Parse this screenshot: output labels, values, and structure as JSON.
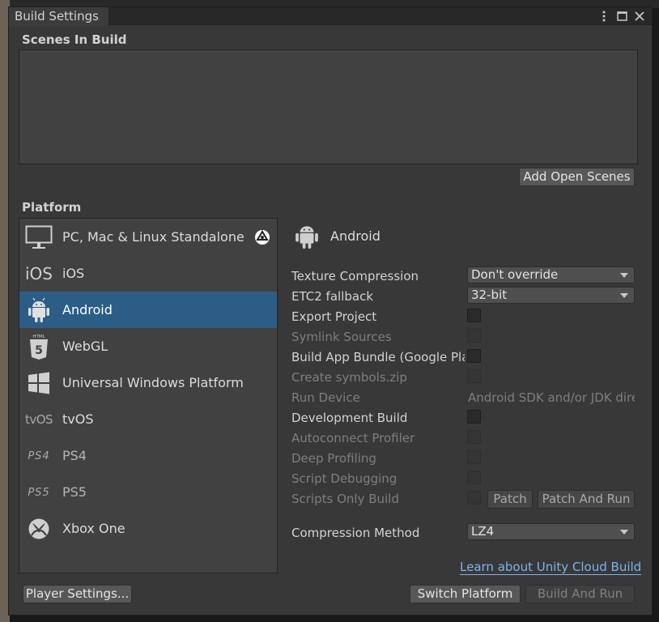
{
  "window": {
    "title": "Build Settings"
  },
  "scenes": {
    "heading": "Scenes In Build",
    "add_open_scenes": "Add Open Scenes"
  },
  "platform": {
    "heading": "Platform",
    "items": [
      {
        "label": "PC, Mac & Linux Standalone",
        "icon": "monitor-icon"
      },
      {
        "label": "iOS",
        "icon": "ios-icon",
        "icon_text": "iOS"
      },
      {
        "label": "Android",
        "icon": "android-icon"
      },
      {
        "label": "WebGL",
        "icon": "html5-icon",
        "icon_text": "HTML"
      },
      {
        "label": "Universal Windows Platform",
        "icon": "windows-icon"
      },
      {
        "label": "tvOS",
        "icon": "tvos-icon",
        "icon_text": "tvOS"
      },
      {
        "label": "PS4",
        "icon": "ps4-icon",
        "icon_text": "PS4"
      },
      {
        "label": "PS5",
        "icon": "ps5-icon",
        "icon_text": "PS5"
      },
      {
        "label": "Xbox One",
        "icon": "xbox-icon"
      }
    ],
    "selected": "Android"
  },
  "settings": {
    "header": "Android",
    "texture_compression": {
      "label": "Texture Compression",
      "value": "Don't override"
    },
    "etc2_fallback": {
      "label": "ETC2 fallback",
      "value": "32-bit"
    },
    "export_project": "Export Project",
    "symlink_sources": "Symlink Sources",
    "build_app_bundle": "Build App Bundle (Google Play)",
    "create_symbols": "Create symbols.zip",
    "run_device": {
      "label": "Run Device",
      "value": "Android SDK and/or JDK dire"
    },
    "development_build": "Development Build",
    "autoconnect_profiler": "Autoconnect Profiler",
    "deep_profiling": "Deep Profiling",
    "script_debugging": "Script Debugging",
    "scripts_only_build": "Scripts Only Build",
    "patch": "Patch",
    "patch_and_run": "Patch And Run",
    "compression_method": {
      "label": "Compression Method",
      "value": "LZ4"
    },
    "cloud_build_link": "Learn about Unity Cloud Build"
  },
  "footer": {
    "player_settings": "Player Settings...",
    "switch_platform": "Switch Platform",
    "build_and_run": "Build And Run"
  },
  "colors": {
    "selection": "#2c5d87",
    "link": "#7ab4f0",
    "window_bg": "#383838"
  }
}
